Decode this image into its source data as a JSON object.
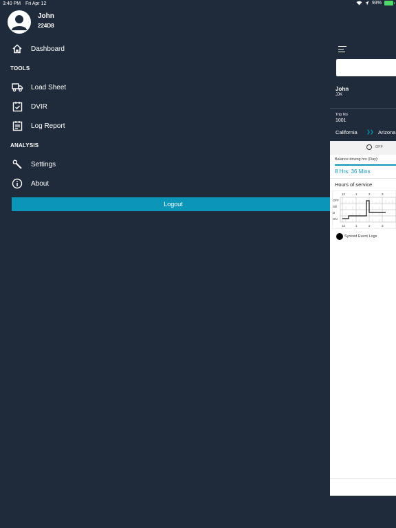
{
  "status_bar": {
    "time": "3:40 PM",
    "date": "Fri Apr 12",
    "battery": "93%"
  },
  "user": {
    "name": "John",
    "id": "224D8"
  },
  "menu": {
    "dashboard": "Dashboard",
    "tools_title": "TOOLS",
    "load_sheet": "Load Sheet",
    "dvir": "DVIR",
    "log_report": "Log Report",
    "analysis_title": "ANALYSIS",
    "settings": "Settings",
    "about": "About",
    "logout": "Logout"
  },
  "panel": {
    "driver_name": "John",
    "driver_code": "JJK",
    "trip_label": "Trip No",
    "trip_no": "1001",
    "from": "California",
    "to": "Arizona",
    "duty_status": "OFF",
    "balance_label": "Balance driving hrs (Day):",
    "balance_value": "8 Hrs: 36 Mins",
    "hos_title": "Hours of service",
    "hos_rows": [
      "OFF",
      "SB",
      "D",
      "ON"
    ],
    "hos_hours": [
      "12",
      "1",
      "2",
      "3"
    ],
    "synced_label": "Synced Event Logs"
  },
  "colors": {
    "background": "#1f2b3a",
    "accent": "#0b95b8",
    "panel": "#ffffff"
  }
}
